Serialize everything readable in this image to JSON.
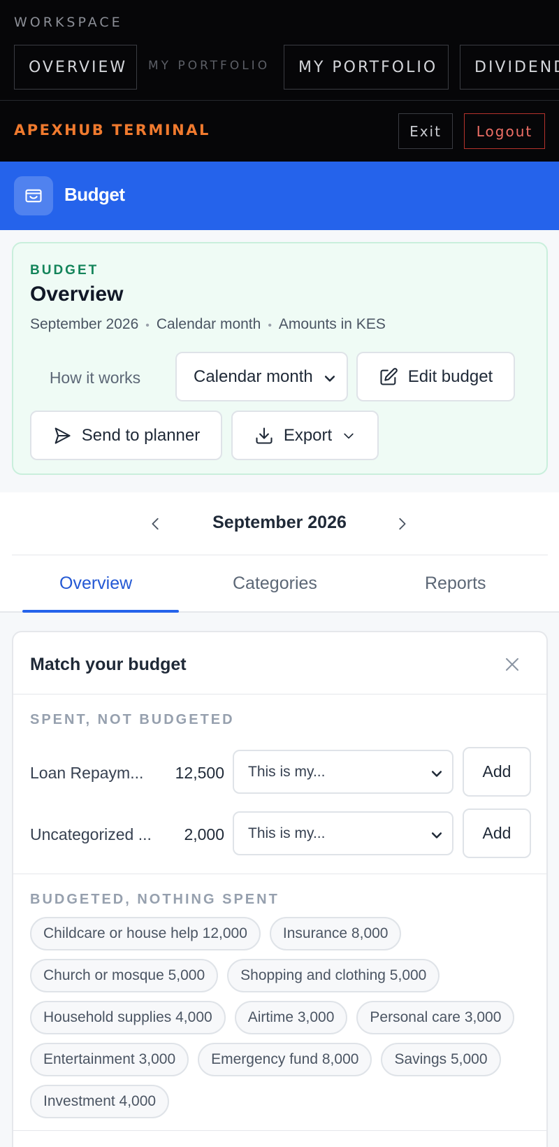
{
  "workspace": {
    "label": "WORKSPACE",
    "nav": [
      {
        "label": "OVERVIEW"
      },
      {
        "label": "MY PORTFOLIO"
      },
      {
        "label": "MY PORTFOLIO"
      },
      {
        "label": "DIVIDEND"
      }
    ],
    "brand": "APEXHUB TERMINAL",
    "exit_label": "Exit",
    "logout_label": "Logout"
  },
  "header": {
    "icon": "wallet-icon",
    "title": "Budget"
  },
  "overview": {
    "eyebrow": "BUDGET",
    "title": "Overview",
    "meta": [
      "September 2026",
      "Calendar month",
      "Amounts in KES"
    ],
    "how_it_works": "How it works",
    "period_select": "Calendar month",
    "edit_label": "Edit budget",
    "send_label": "Send to planner",
    "export_label": "Export"
  },
  "month_nav": {
    "label": "September 2026"
  },
  "tabs": [
    {
      "label": "Overview",
      "active": true
    },
    {
      "label": "Categories",
      "active": false
    },
    {
      "label": "Reports",
      "active": false
    }
  ],
  "match": {
    "title": "Match your budget",
    "spent_not_budgeted": {
      "heading": "SPENT, NOT BUDGETED",
      "rows": [
        {
          "name": "Loan Repaym...",
          "amount": "12,500",
          "select": "This is my...",
          "action": "Add"
        },
        {
          "name": "Uncategorized ...",
          "amount": "2,000",
          "select": "This is my...",
          "action": "Add"
        }
      ]
    },
    "budgeted_nothing_spent": {
      "heading": "BUDGETED, NOTHING SPENT",
      "chips": [
        "Childcare or house help 12,000",
        "Insurance 8,000",
        "Church or mosque 5,000",
        "Shopping and clothing 5,000",
        "Household supplies 4,000",
        "Airtime 3,000",
        "Personal care 3,000",
        "Entertainment 3,000",
        "Emergency fund 8,000",
        "Savings 5,000",
        "Investment 4,000"
      ]
    }
  },
  "colors": {
    "accent": "#2563eb",
    "brand": "#f07a2e",
    "logout": "#ef6f66",
    "eyebrow_green": "#13845a"
  }
}
